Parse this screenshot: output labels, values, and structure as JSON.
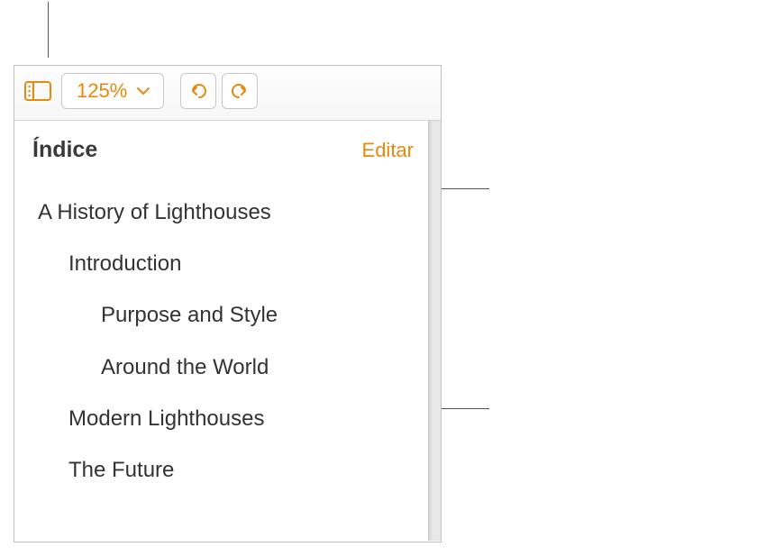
{
  "toolbar": {
    "zoom_value": "125%",
    "sidebar_icon": "sidebar-icon",
    "zoom_chevron": "chevron-down-icon",
    "undo_icon": "undo-icon",
    "redo_icon": "redo-icon"
  },
  "index": {
    "title": "Índice",
    "edit_label": "Editar"
  },
  "toc": [
    {
      "label": "A History of Lighthouses",
      "level": 0
    },
    {
      "label": "Introduction",
      "level": 1
    },
    {
      "label": "Purpose and Style",
      "level": 2
    },
    {
      "label": "Around the World",
      "level": 2
    },
    {
      "label": "Modern Lighthouses",
      "level": 1
    },
    {
      "label": "The Future",
      "level": 1
    }
  ],
  "colors": {
    "accent": "#e8890c"
  }
}
